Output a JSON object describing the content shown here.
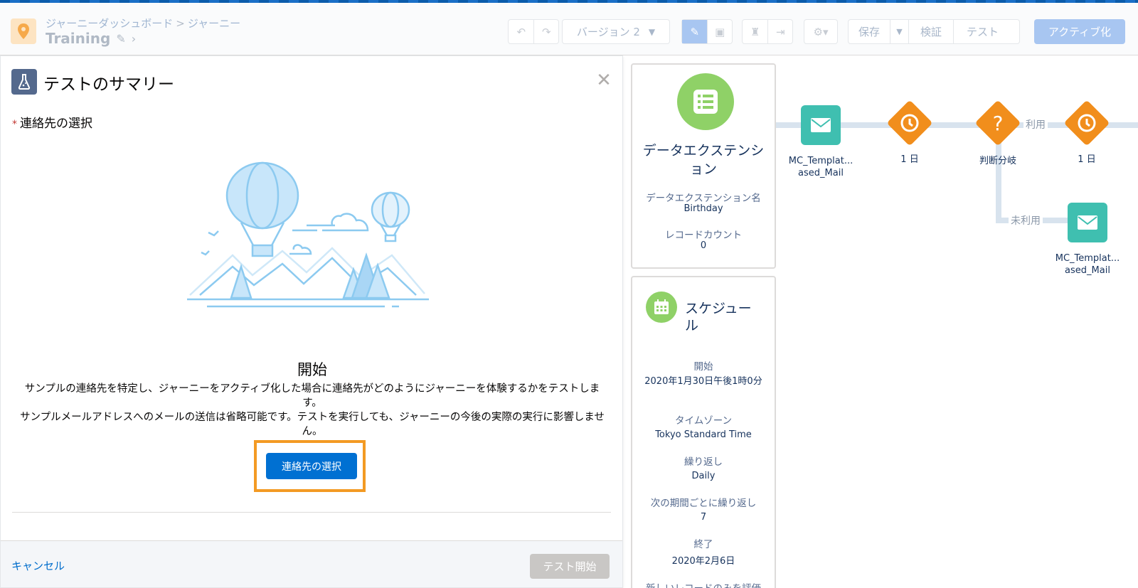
{
  "header": {
    "breadcrumb": [
      "ジャーニーダッシュボード",
      "ジャーニー"
    ],
    "breadcrumb_sep": ">",
    "journey_name": "Training",
    "version_label": "バージョン 2",
    "save_label": "保存",
    "validate_label": "検証",
    "test_label": "テスト",
    "activate_label": "アクティブ化"
  },
  "panel": {
    "title": "テストのサマリー",
    "required_label": "連絡先の選択",
    "heading": "開始",
    "description_1": "サンプルの連絡先を特定し、ジャーニーをアクティブ化した場合に連絡先がどのようにジャーニーを体験するかをテストします。",
    "description_2": "サンプルメールアドレスへのメールの送信は省略可能です。テストを実行しても、ジャーニーの今後の実際の実行に影響しません。",
    "select_contact_button": "連絡先の選択",
    "cancel_label": "キャンセル",
    "start_test_button": "テスト開始"
  },
  "entry_card": {
    "title": "データエクステンション",
    "de_name_label": "データエクステンション名",
    "de_name_value": "Birthday",
    "record_count_label": "レコードカウント",
    "record_count_value": "0"
  },
  "schedule_card": {
    "title": "スケジュール",
    "start_label": "開始",
    "start_value": "2020年1月30日午後1時0分",
    "timezone_label": "タイムゾーン",
    "timezone_value": "Tokyo Standard Time",
    "repeat_label": "繰り返し",
    "repeat_value": "Daily",
    "repeat_every_label": "次の期間ごとに繰り返し",
    "repeat_every_value": "7",
    "end_label": "終了",
    "end_value": "2020年2月6日",
    "new_records_label": "新しいレコードのみを評価"
  },
  "canvas": {
    "email_1": "MC_Templat...\nased_Mail",
    "wait_1": "1 日",
    "decision": "判断分岐",
    "wait_2": "1 日",
    "email_2": "MC_Templat...\nased_Mail",
    "path_yes": "利用",
    "path_no": "未利用"
  },
  "icons": [
    "location-pin-icon",
    "pencil-icon",
    "chevron-right-icon",
    "undo-icon",
    "redo-icon",
    "caret-down-icon",
    "edit-icon",
    "stamp-icon",
    "trophy-icon",
    "exit-icon",
    "gear-icon",
    "flask-icon",
    "close-icon",
    "list-icon",
    "calendar-icon",
    "mail-icon",
    "clock-icon",
    "question-icon"
  ],
  "colors": {
    "primary": "#0070d2",
    "highlight": "#f39a23",
    "entry_green": "#8fd167",
    "email_teal": "#3fbfb0",
    "activity_orange": "#f18e1c"
  }
}
